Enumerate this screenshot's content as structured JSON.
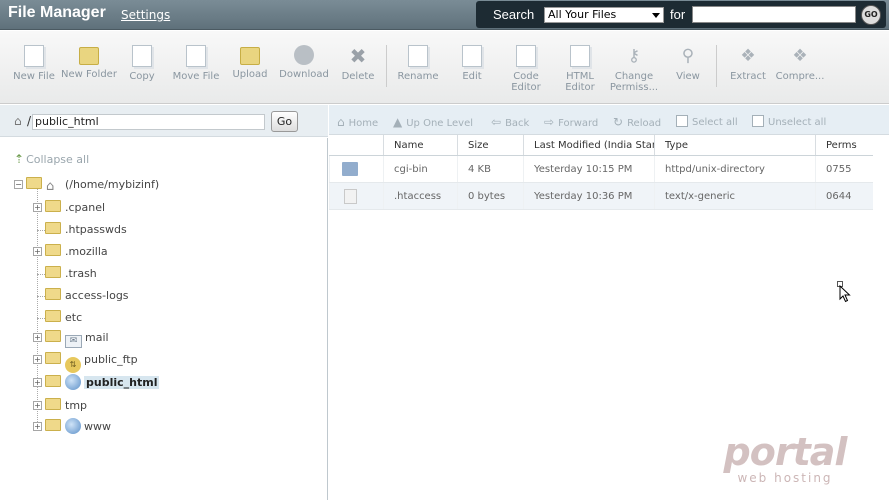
{
  "header": {
    "title": "File Manager",
    "settings": "Settings",
    "search_label": "Search",
    "search_scope": "All Your Files",
    "for_label": "for",
    "search_value": "",
    "go_label": "GO"
  },
  "toolbar": {
    "items": [
      {
        "label": "New File"
      },
      {
        "label": "New Folder"
      },
      {
        "label": "Copy"
      },
      {
        "label": "Move File"
      },
      {
        "label": "Upload"
      },
      {
        "label": "Download"
      },
      {
        "label": "Delete"
      },
      {
        "label": "Rename"
      },
      {
        "label": "Edit"
      },
      {
        "label": "Code Editor"
      },
      {
        "label": "HTML Editor"
      },
      {
        "label": "Change Permiss..."
      },
      {
        "label": "View"
      },
      {
        "label": "Extract"
      },
      {
        "label": "Compre..."
      }
    ]
  },
  "path": {
    "value": "public_html",
    "go": "Go"
  },
  "nav": {
    "home": "Home",
    "up": "Up One Level",
    "back": "Back",
    "forward": "Forward",
    "reload": "Reload",
    "select_all": "Select all",
    "unselect_all": "Unselect all"
  },
  "tree": {
    "collapse_all": "Collapse all",
    "root": "(/home/mybizinf)",
    "items": [
      {
        "label": ".cpanel"
      },
      {
        "label": ".htpasswds"
      },
      {
        "label": ".mozilla"
      },
      {
        "label": ".trash"
      },
      {
        "label": "access-logs"
      },
      {
        "label": "etc"
      },
      {
        "label": "mail"
      },
      {
        "label": "public_ftp"
      },
      {
        "label": "public_html"
      },
      {
        "label": "tmp"
      },
      {
        "label": "www"
      }
    ]
  },
  "table": {
    "columns": [
      "Name",
      "Size",
      "Last Modified (India Standard Time)",
      "Type",
      "Perms"
    ],
    "rows": [
      {
        "name": "cgi-bin",
        "size": "4 KB",
        "modified": "Yesterday 10:15 PM",
        "type": "httpd/unix-directory",
        "perms": "0755"
      },
      {
        "name": ".htaccess",
        "size": "0 bytes",
        "modified": "Yesterday 10:36 PM",
        "type": "text/x-generic",
        "perms": "0644"
      }
    ]
  },
  "watermark": {
    "brand": "portal",
    "sub": "web hosting"
  }
}
